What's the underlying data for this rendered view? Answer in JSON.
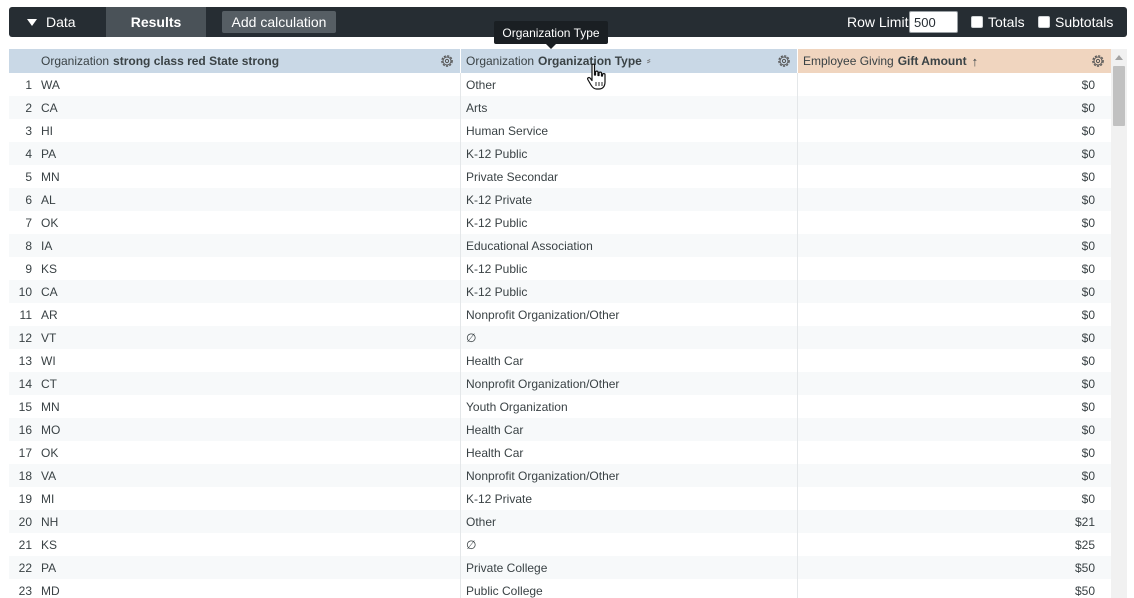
{
  "toolbar": {
    "data_tab": "Data",
    "results_tab": "Results",
    "add_calculation": "Add calculation",
    "row_limit_label": "Row Limit",
    "row_limit_value": "500",
    "totals_label": "Totals",
    "subtotals_label": "Subtotals"
  },
  "tooltip": "Organization Type",
  "columns": [
    {
      "prefix": "Organization",
      "name": "strong class red State strong",
      "icon": "gear-icon"
    },
    {
      "prefix": "Organization",
      "name": "Organization Type",
      "extra_icon": "pivot-icon",
      "icon": "gear-icon"
    },
    {
      "prefix": "Employee Giving",
      "name": "Gift Amount",
      "sort": "↑",
      "icon": "gear-icon"
    }
  ],
  "rows": [
    {
      "n": "1",
      "state": "WA",
      "type": "Other",
      "amount": "$0"
    },
    {
      "n": "2",
      "state": "CA",
      "type": "Arts",
      "amount": "$0"
    },
    {
      "n": "3",
      "state": "HI",
      "type": "Human Service",
      "amount": "$0"
    },
    {
      "n": "4",
      "state": "PA",
      "type": "K-12 Public",
      "amount": "$0"
    },
    {
      "n": "5",
      "state": "MN",
      "type": "Private Secondar",
      "amount": "$0"
    },
    {
      "n": "6",
      "state": "AL",
      "type": "K-12 Private",
      "amount": "$0"
    },
    {
      "n": "7",
      "state": "OK",
      "type": "K-12 Public",
      "amount": "$0"
    },
    {
      "n": "8",
      "state": "IA",
      "type": "Educational Association",
      "amount": "$0"
    },
    {
      "n": "9",
      "state": "KS",
      "type": "K-12 Public",
      "amount": "$0"
    },
    {
      "n": "10",
      "state": "CA",
      "type": "K-12 Public",
      "amount": "$0"
    },
    {
      "n": "11",
      "state": "AR",
      "type": "Nonprofit Organization/Other",
      "amount": "$0"
    },
    {
      "n": "12",
      "state": "VT",
      "type": "∅",
      "amount": "$0"
    },
    {
      "n": "13",
      "state": "WI",
      "type": "Health Car",
      "amount": "$0"
    },
    {
      "n": "14",
      "state": "CT",
      "type": "Nonprofit Organization/Other",
      "amount": "$0"
    },
    {
      "n": "15",
      "state": "MN",
      "type": "Youth Organization",
      "amount": "$0"
    },
    {
      "n": "16",
      "state": "MO",
      "type": "Health Car",
      "amount": "$0"
    },
    {
      "n": "17",
      "state": "OK",
      "type": "Health Car",
      "amount": "$0"
    },
    {
      "n": "18",
      "state": "VA",
      "type": "Nonprofit Organization/Other",
      "amount": "$0"
    },
    {
      "n": "19",
      "state": "MI",
      "type": "K-12 Private",
      "amount": "$0"
    },
    {
      "n": "20",
      "state": "NH",
      "type": "Other",
      "amount": "$21"
    },
    {
      "n": "21",
      "state": "KS",
      "type": "∅",
      "amount": "$25"
    },
    {
      "n": "22",
      "state": "PA",
      "type": "Private College",
      "amount": "$50"
    },
    {
      "n": "23",
      "state": "MD",
      "type": "Public College",
      "amount": "$50"
    }
  ]
}
